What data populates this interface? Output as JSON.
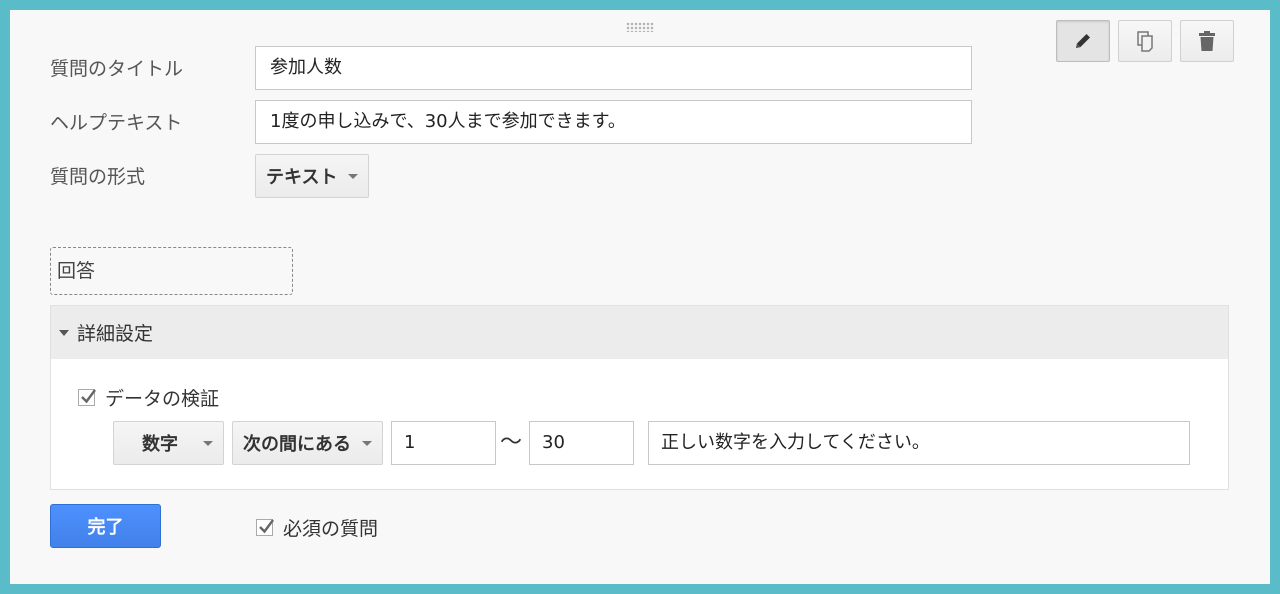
{
  "toolbar": {
    "edit_icon": "pencil-icon",
    "duplicate_icon": "copy-icon",
    "delete_icon": "trash-icon"
  },
  "question": {
    "title_label": "質問のタイトル",
    "title_value": "参加人数",
    "help_label": "ヘルプテキスト",
    "help_value": "1度の申し込みで、30人まで参加できます。",
    "type_label": "質問の形式",
    "type_value": "テキスト"
  },
  "answer": {
    "label": "回答"
  },
  "advanced": {
    "header": "詳細設定",
    "validation_label": "データの検証",
    "validation_checked": true,
    "rule_type": "数字",
    "rule_condition": "次の間にある",
    "min_value": "1",
    "range_separator": "〜",
    "max_value": "30",
    "error_text": "正しい数字を入力してください。"
  },
  "footer": {
    "done_label": "完了",
    "required_label": "必須の質問",
    "required_checked": true
  },
  "colors": {
    "frame": "#5bbcc9",
    "primary_button": "#4d90fe"
  }
}
